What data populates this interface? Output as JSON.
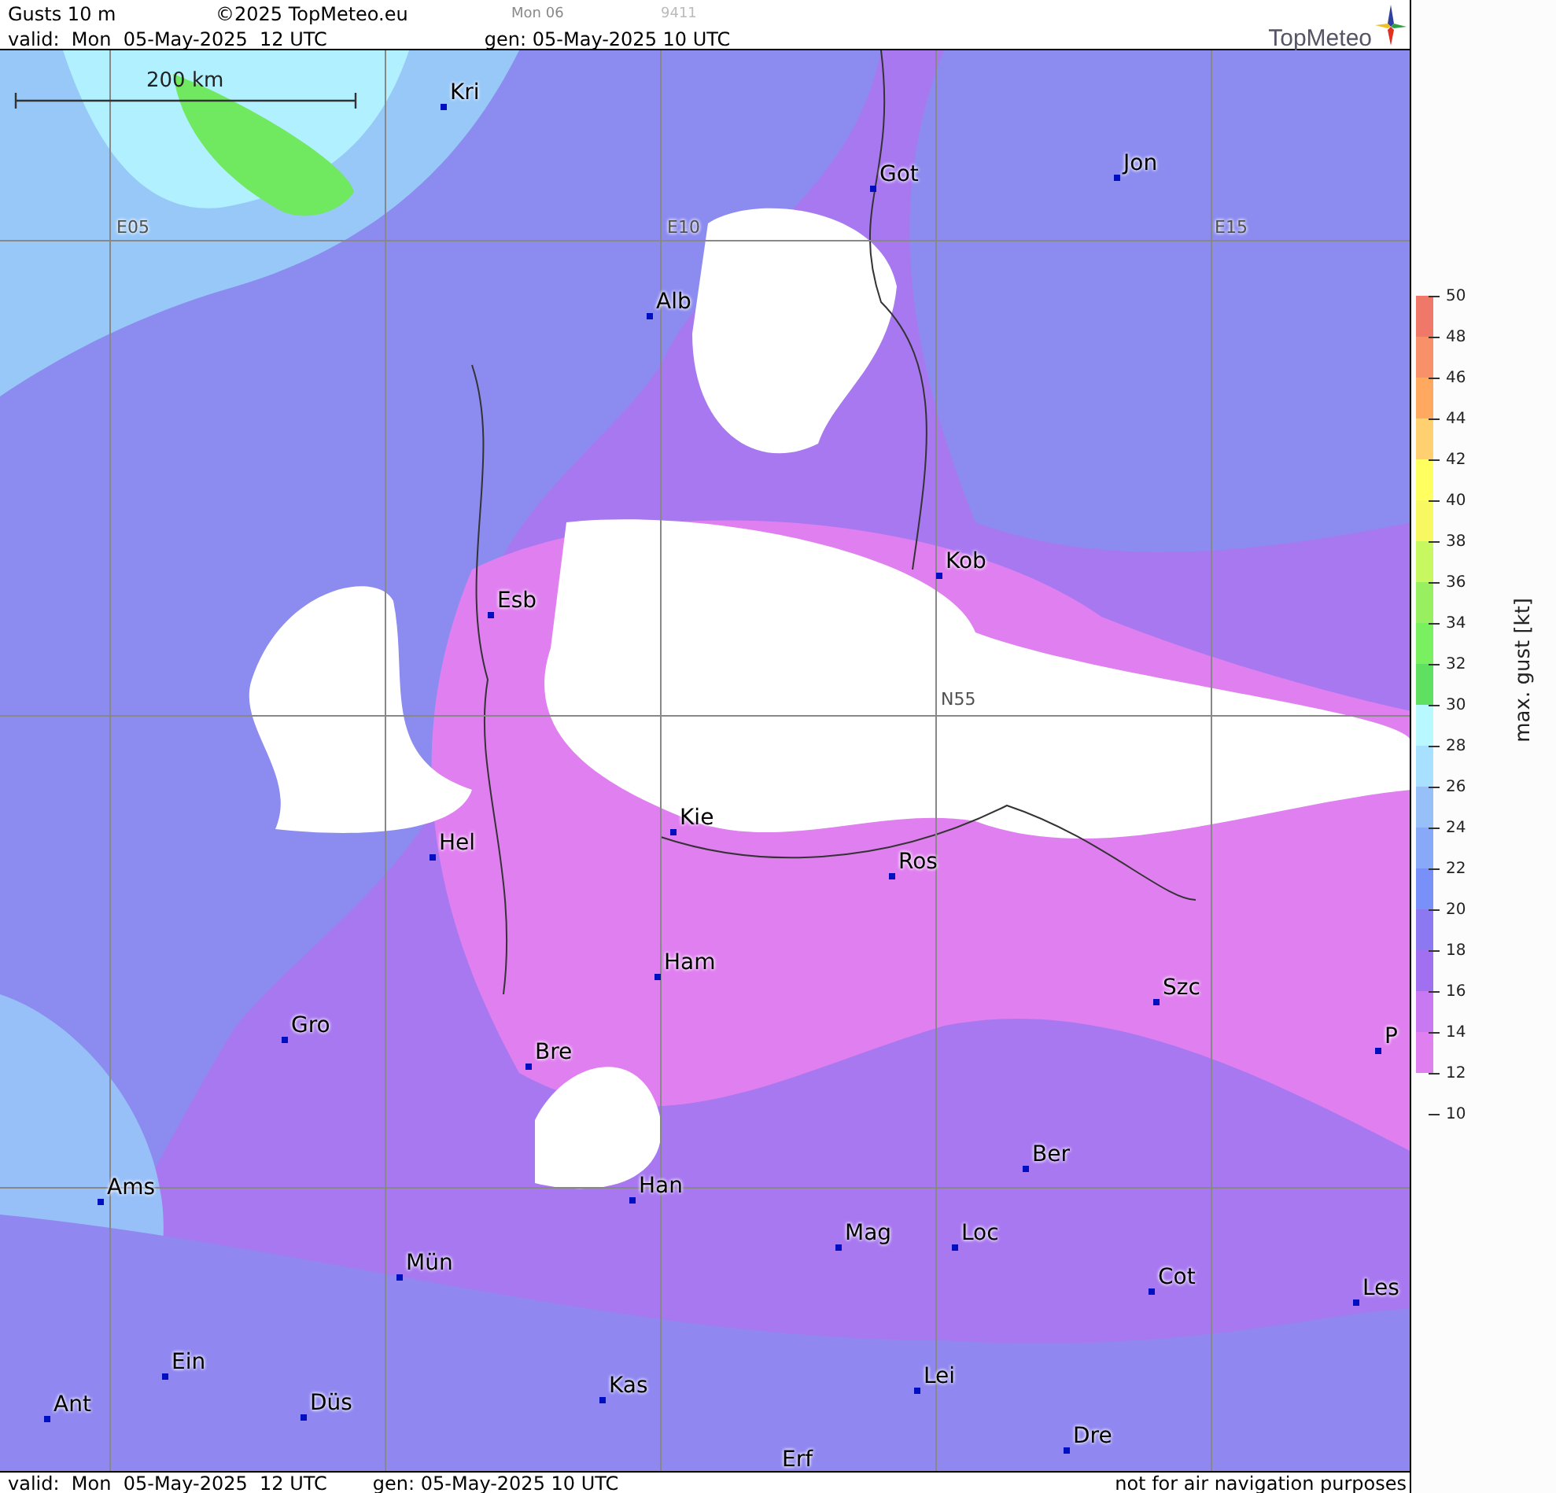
{
  "header": {
    "title": "Gusts 10 m",
    "copyright": "©2025 TopMeteo.eu",
    "next_run": "Mon 06",
    "code": "9411",
    "valid": "valid:  Mon  05-May-2025  12 UTC",
    "generated": "gen: 05-May-2025 10 UTC",
    "logo": "TopMeteo"
  },
  "map": {
    "scale": "200 km",
    "grid_labels": [
      "E05",
      "E10",
      "E15",
      "N55"
    ],
    "cities": [
      "Kri",
      "Got",
      "Jon",
      "Alb",
      "Kob",
      "Esb",
      "Kie",
      "Hel",
      "Ros",
      "Ham",
      "Szc",
      "Gro",
      "P",
      "Bre",
      "Ber",
      "Ams",
      "Han",
      "Mag",
      "Loc",
      "Mün",
      "Cot",
      "Les",
      "Ein",
      "Kas",
      "Lei",
      "Ant",
      "Düs",
      "Dre",
      "Erf"
    ]
  },
  "legend": {
    "title": "max. gust [kt]",
    "ticks": [
      "50",
      "48",
      "46",
      "44",
      "42",
      "40",
      "38",
      "36",
      "34",
      "32",
      "30",
      "28",
      "26",
      "24",
      "22",
      "20",
      "18",
      "16",
      "14",
      "12",
      "10"
    ],
    "bands": [
      {
        "color": "#f07868"
      },
      {
        "color": "#f8906a"
      },
      {
        "color": "#ffa860"
      },
      {
        "color": "#ffd070"
      },
      {
        "color": "#ffff60"
      },
      {
        "color": "#f8f860"
      },
      {
        "color": "#c8f860"
      },
      {
        "color": "#98f060"
      },
      {
        "color": "#78f060"
      },
      {
        "color": "#60e060"
      },
      {
        "color": "#b8f8ff"
      },
      {
        "color": "#a8e0ff"
      },
      {
        "color": "#98c0f8"
      },
      {
        "color": "#88a8f8"
      },
      {
        "color": "#7890f8"
      },
      {
        "color": "#8c78f0"
      },
      {
        "color": "#a070f0"
      },
      {
        "color": "#c878f0"
      },
      {
        "color": "#e080f0"
      }
    ]
  },
  "footer": {
    "valid": "valid:  Mon  05-May-2025  12 UTC",
    "generated": "gen: 05-May-2025 10 UTC",
    "note": "not for air navigation purposes"
  }
}
